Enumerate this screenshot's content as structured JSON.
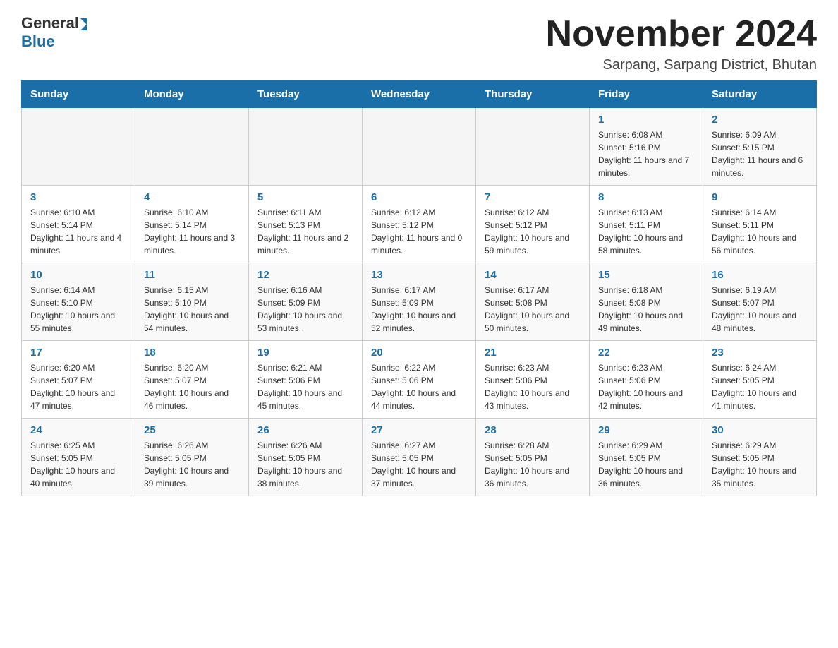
{
  "logo": {
    "general": "General",
    "blue": "Blue"
  },
  "header": {
    "month_title": "November 2024",
    "location": "Sarpang, Sarpang District, Bhutan"
  },
  "weekdays": [
    "Sunday",
    "Monday",
    "Tuesday",
    "Wednesday",
    "Thursday",
    "Friday",
    "Saturday"
  ],
  "weeks": [
    [
      {
        "day": "",
        "sunrise": "",
        "sunset": "",
        "daylight": ""
      },
      {
        "day": "",
        "sunrise": "",
        "sunset": "",
        "daylight": ""
      },
      {
        "day": "",
        "sunrise": "",
        "sunset": "",
        "daylight": ""
      },
      {
        "day": "",
        "sunrise": "",
        "sunset": "",
        "daylight": ""
      },
      {
        "day": "",
        "sunrise": "",
        "sunset": "",
        "daylight": ""
      },
      {
        "day": "1",
        "sunrise": "Sunrise: 6:08 AM",
        "sunset": "Sunset: 5:16 PM",
        "daylight": "Daylight: 11 hours and 7 minutes."
      },
      {
        "day": "2",
        "sunrise": "Sunrise: 6:09 AM",
        "sunset": "Sunset: 5:15 PM",
        "daylight": "Daylight: 11 hours and 6 minutes."
      }
    ],
    [
      {
        "day": "3",
        "sunrise": "Sunrise: 6:10 AM",
        "sunset": "Sunset: 5:14 PM",
        "daylight": "Daylight: 11 hours and 4 minutes."
      },
      {
        "day": "4",
        "sunrise": "Sunrise: 6:10 AM",
        "sunset": "Sunset: 5:14 PM",
        "daylight": "Daylight: 11 hours and 3 minutes."
      },
      {
        "day": "5",
        "sunrise": "Sunrise: 6:11 AM",
        "sunset": "Sunset: 5:13 PM",
        "daylight": "Daylight: 11 hours and 2 minutes."
      },
      {
        "day": "6",
        "sunrise": "Sunrise: 6:12 AM",
        "sunset": "Sunset: 5:12 PM",
        "daylight": "Daylight: 11 hours and 0 minutes."
      },
      {
        "day": "7",
        "sunrise": "Sunrise: 6:12 AM",
        "sunset": "Sunset: 5:12 PM",
        "daylight": "Daylight: 10 hours and 59 minutes."
      },
      {
        "day": "8",
        "sunrise": "Sunrise: 6:13 AM",
        "sunset": "Sunset: 5:11 PM",
        "daylight": "Daylight: 10 hours and 58 minutes."
      },
      {
        "day": "9",
        "sunrise": "Sunrise: 6:14 AM",
        "sunset": "Sunset: 5:11 PM",
        "daylight": "Daylight: 10 hours and 56 minutes."
      }
    ],
    [
      {
        "day": "10",
        "sunrise": "Sunrise: 6:14 AM",
        "sunset": "Sunset: 5:10 PM",
        "daylight": "Daylight: 10 hours and 55 minutes."
      },
      {
        "day": "11",
        "sunrise": "Sunrise: 6:15 AM",
        "sunset": "Sunset: 5:10 PM",
        "daylight": "Daylight: 10 hours and 54 minutes."
      },
      {
        "day": "12",
        "sunrise": "Sunrise: 6:16 AM",
        "sunset": "Sunset: 5:09 PM",
        "daylight": "Daylight: 10 hours and 53 minutes."
      },
      {
        "day": "13",
        "sunrise": "Sunrise: 6:17 AM",
        "sunset": "Sunset: 5:09 PM",
        "daylight": "Daylight: 10 hours and 52 minutes."
      },
      {
        "day": "14",
        "sunrise": "Sunrise: 6:17 AM",
        "sunset": "Sunset: 5:08 PM",
        "daylight": "Daylight: 10 hours and 50 minutes."
      },
      {
        "day": "15",
        "sunrise": "Sunrise: 6:18 AM",
        "sunset": "Sunset: 5:08 PM",
        "daylight": "Daylight: 10 hours and 49 minutes."
      },
      {
        "day": "16",
        "sunrise": "Sunrise: 6:19 AM",
        "sunset": "Sunset: 5:07 PM",
        "daylight": "Daylight: 10 hours and 48 minutes."
      }
    ],
    [
      {
        "day": "17",
        "sunrise": "Sunrise: 6:20 AM",
        "sunset": "Sunset: 5:07 PM",
        "daylight": "Daylight: 10 hours and 47 minutes."
      },
      {
        "day": "18",
        "sunrise": "Sunrise: 6:20 AM",
        "sunset": "Sunset: 5:07 PM",
        "daylight": "Daylight: 10 hours and 46 minutes."
      },
      {
        "day": "19",
        "sunrise": "Sunrise: 6:21 AM",
        "sunset": "Sunset: 5:06 PM",
        "daylight": "Daylight: 10 hours and 45 minutes."
      },
      {
        "day": "20",
        "sunrise": "Sunrise: 6:22 AM",
        "sunset": "Sunset: 5:06 PM",
        "daylight": "Daylight: 10 hours and 44 minutes."
      },
      {
        "day": "21",
        "sunrise": "Sunrise: 6:23 AM",
        "sunset": "Sunset: 5:06 PM",
        "daylight": "Daylight: 10 hours and 43 minutes."
      },
      {
        "day": "22",
        "sunrise": "Sunrise: 6:23 AM",
        "sunset": "Sunset: 5:06 PM",
        "daylight": "Daylight: 10 hours and 42 minutes."
      },
      {
        "day": "23",
        "sunrise": "Sunrise: 6:24 AM",
        "sunset": "Sunset: 5:05 PM",
        "daylight": "Daylight: 10 hours and 41 minutes."
      }
    ],
    [
      {
        "day": "24",
        "sunrise": "Sunrise: 6:25 AM",
        "sunset": "Sunset: 5:05 PM",
        "daylight": "Daylight: 10 hours and 40 minutes."
      },
      {
        "day": "25",
        "sunrise": "Sunrise: 6:26 AM",
        "sunset": "Sunset: 5:05 PM",
        "daylight": "Daylight: 10 hours and 39 minutes."
      },
      {
        "day": "26",
        "sunrise": "Sunrise: 6:26 AM",
        "sunset": "Sunset: 5:05 PM",
        "daylight": "Daylight: 10 hours and 38 minutes."
      },
      {
        "day": "27",
        "sunrise": "Sunrise: 6:27 AM",
        "sunset": "Sunset: 5:05 PM",
        "daylight": "Daylight: 10 hours and 37 minutes."
      },
      {
        "day": "28",
        "sunrise": "Sunrise: 6:28 AM",
        "sunset": "Sunset: 5:05 PM",
        "daylight": "Daylight: 10 hours and 36 minutes."
      },
      {
        "day": "29",
        "sunrise": "Sunrise: 6:29 AM",
        "sunset": "Sunset: 5:05 PM",
        "daylight": "Daylight: 10 hours and 36 minutes."
      },
      {
        "day": "30",
        "sunrise": "Sunrise: 6:29 AM",
        "sunset": "Sunset: 5:05 PM",
        "daylight": "Daylight: 10 hours and 35 minutes."
      }
    ]
  ]
}
